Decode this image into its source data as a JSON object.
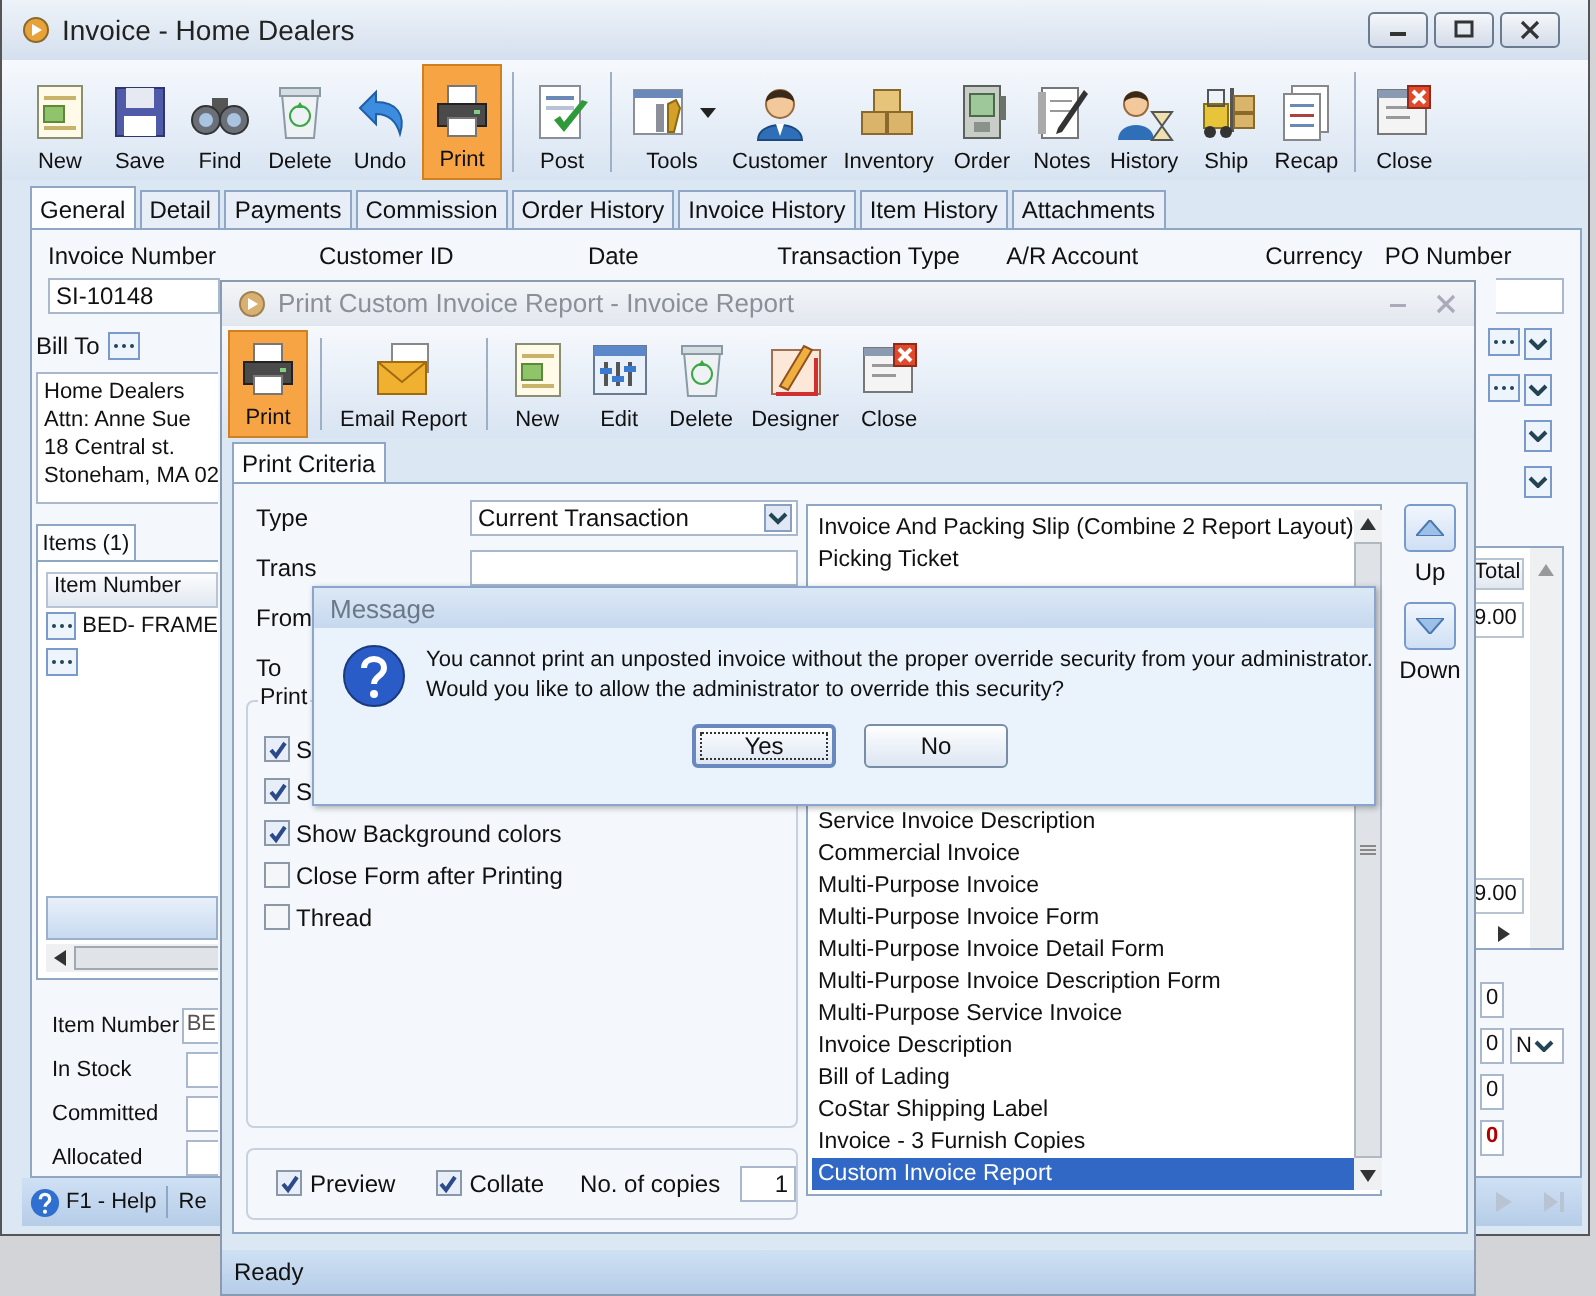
{
  "main_window": {
    "title": "Invoice - Home Dealers",
    "toolbar": [
      {
        "label": "New",
        "selected": false,
        "has_menu": false
      },
      {
        "label": "Save",
        "selected": false,
        "has_menu": false
      },
      {
        "label": "Find",
        "selected": false,
        "has_menu": false
      },
      {
        "label": "Delete",
        "selected": false,
        "has_menu": false
      },
      {
        "label": "Undo",
        "selected": false,
        "has_menu": false
      },
      {
        "label": "Print",
        "selected": true,
        "has_menu": false
      },
      {
        "label": "Post",
        "selected": false,
        "has_menu": false
      },
      {
        "label": "Tools",
        "selected": false,
        "has_menu": true
      },
      {
        "label": "Customer",
        "selected": false,
        "has_menu": false
      },
      {
        "label": "Inventory",
        "selected": false,
        "has_menu": false
      },
      {
        "label": "Order",
        "selected": false,
        "has_menu": false
      },
      {
        "label": "Notes",
        "selected": false,
        "has_menu": false
      },
      {
        "label": "History",
        "selected": false,
        "has_menu": false
      },
      {
        "label": "Ship",
        "selected": false,
        "has_menu": false
      },
      {
        "label": "Recap",
        "selected": false,
        "has_menu": false
      },
      {
        "label": "Close",
        "selected": false,
        "has_menu": false
      }
    ],
    "tabs": [
      {
        "label": "General",
        "selected": true
      },
      {
        "label": "Detail",
        "selected": false
      },
      {
        "label": "Payments",
        "selected": false
      },
      {
        "label": "Commission",
        "selected": false
      },
      {
        "label": "Order History",
        "selected": false
      },
      {
        "label": "Invoice History",
        "selected": false
      },
      {
        "label": "Item History",
        "selected": false
      },
      {
        "label": "Attachments",
        "selected": false
      }
    ],
    "field_labels": [
      "Invoice Number",
      "Customer ID",
      "Date",
      "Transaction Type",
      "A/R Account",
      "Currency",
      "PO Number"
    ],
    "invoice_number": "SI-10148",
    "bill_to": {
      "label": "Bill To",
      "address": [
        "Home Dealers",
        "Attn: Anne Sue",
        "18 Central st.",
        "Stoneham, MA 02"
      ]
    },
    "items_tab": "Items (1)",
    "grid": {
      "columns": [
        "Item Number",
        "Total"
      ],
      "rows": [
        {
          "item_number": "BED- FRAME",
          "total": "9.00"
        }
      ],
      "footer_total": "9.00"
    },
    "item_info": [
      {
        "label": "Item Number",
        "value": "BE"
      },
      {
        "label": "In Stock"
      },
      {
        "label": "Committed"
      },
      {
        "label": "Allocated"
      }
    ],
    "right_fields": [
      {
        "value": "0",
        "highlighted": false
      },
      {
        "value": "0",
        "highlighted": false,
        "unit": "N"
      },
      {
        "value": "0",
        "highlighted": false
      },
      {
        "value": "0",
        "highlighted": true
      }
    ],
    "status_bar": {
      "help": "F1 - Help",
      "text": "Re"
    }
  },
  "print_dialog": {
    "title": "Print Custom Invoice Report - Invoice Report",
    "toolbar": [
      {
        "label": "Print",
        "selected": true
      },
      {
        "label": "Email Report",
        "selected": false
      },
      {
        "label": "New",
        "selected": false
      },
      {
        "label": "Edit",
        "selected": false
      },
      {
        "label": "Delete",
        "selected": false
      },
      {
        "label": "Designer",
        "selected": false
      },
      {
        "label": "Close",
        "selected": false
      }
    ],
    "tab": "Print Criteria",
    "type_label": "Type",
    "type_value": "Current Transaction",
    "row_labels": [
      "Trans",
      "From",
      "To"
    ],
    "group_title": "Print",
    "options": [
      {
        "label": "S",
        "checked": true
      },
      {
        "label": "S",
        "checked": true
      },
      {
        "label": "Show Background colors",
        "checked": true
      },
      {
        "label": "Close Form after Printing",
        "checked": false
      },
      {
        "label": "Thread",
        "checked": false
      }
    ],
    "preview": {
      "label": "Preview",
      "checked": true
    },
    "collate": {
      "label": "Collate",
      "checked": true
    },
    "copies_label": "No. of copies",
    "copies": "1",
    "reports_top": [
      {
        "label": "Invoice And Packing Slip (Combine 2 Report Layout)",
        "selected": false
      },
      {
        "label": "Picking Ticket",
        "selected": false
      }
    ],
    "reports": [
      {
        "label": "Service Invoice Description",
        "selected": false
      },
      {
        "label": "Commercial Invoice",
        "selected": false
      },
      {
        "label": "Multi-Purpose Invoice",
        "selected": false
      },
      {
        "label": "Multi-Purpose Invoice Form",
        "selected": false
      },
      {
        "label": "Multi-Purpose Invoice Detail Form",
        "selected": false
      },
      {
        "label": "Multi-Purpose Invoice Description Form",
        "selected": false
      },
      {
        "label": "Multi-Purpose Service Invoice",
        "selected": false
      },
      {
        "label": "Invoice Description",
        "selected": false
      },
      {
        "label": "Bill of Lading",
        "selected": false
      },
      {
        "label": "CoStar Shipping Label",
        "selected": false
      },
      {
        "label": "Invoice - 3 Furnish Copies",
        "selected": false
      },
      {
        "label": "Custom Invoice Report",
        "selected": true
      }
    ],
    "up": "Up",
    "down": "Down",
    "status": "Ready"
  },
  "message_box": {
    "title": "Message",
    "text": "You cannot print an unposted invoice without the proper override security from your administrator.\nWould you like to allow the administrator to override this security?",
    "buttons": [
      {
        "label": "Yes",
        "default": true
      },
      {
        "label": "No",
        "default": false
      }
    ]
  }
}
